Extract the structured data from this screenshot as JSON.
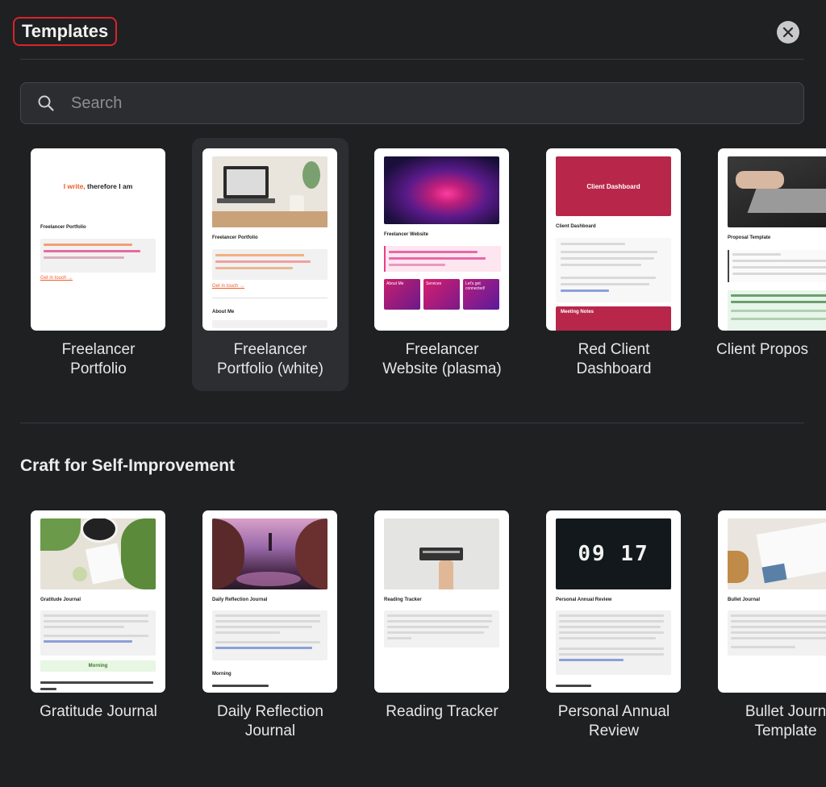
{
  "header": {
    "title": "Templates",
    "close_icon": "close-icon"
  },
  "search": {
    "placeholder": "Search",
    "value": ""
  },
  "section_top": {
    "cards": [
      {
        "label_line1": "Freelancer",
        "label_line2": "Portfolio"
      },
      {
        "label_line1": "Freelancer",
        "label_line2": "Portfolio (white)"
      },
      {
        "label_line1": "Freelancer",
        "label_line2": "Website (plasma)"
      },
      {
        "label_line1": "Red Client",
        "label_line2": "Dashboard"
      },
      {
        "label_line1": "Client Propos",
        "label_line2": ""
      }
    ]
  },
  "section_self": {
    "title": "Craft for Self-Improvement",
    "cards": [
      {
        "label_line1": "Gratitude Journal",
        "label_line2": ""
      },
      {
        "label_line1": "Daily Reflection",
        "label_line2": "Journal"
      },
      {
        "label_line1": "Reading Tracker",
        "label_line2": ""
      },
      {
        "label_line1": "Personal Annual",
        "label_line2": "Review"
      },
      {
        "label_line1": "Bullet Journ",
        "label_line2": "Template"
      }
    ]
  },
  "thumbs": {
    "t1_headline_a": "I write,",
    "t1_headline_b": " therefore I am",
    "t1_heading": "Freelancer Portfolio",
    "t1_link": "Get in touch →",
    "t2_heading": "Freelancer Portfolio",
    "t2_link": "Get in touch →",
    "t2_sub": "About Me",
    "t3_heading": "Freelancer Website",
    "t3_btn1": "About Me",
    "t3_btn2": "Services",
    "t3_btn3": "Let's get connected!",
    "t4_banner": "Client Dashboard",
    "t4_heading": "Client Dashboard",
    "t4_sub": "Meeting Notes",
    "t5_heading": "Proposal Template",
    "t6_heading": "Gratitude Journal",
    "t6_band": "Morning",
    "t7_heading": "Daily Reflection Journal",
    "t7_sub": "Morning",
    "t8_heading": "Reading Tracker",
    "t9_heading": "Personal Annual Review",
    "t9_digits": "09 17",
    "t10_heading": "Bullet Journal"
  },
  "colors": {
    "background": "#1f2022",
    "selected_card": "#2d2e31",
    "highlight_border": "#d8242d",
    "accent_orange": "#f05a28",
    "accent_pink": "#e83e8c",
    "client_red": "#b8274a"
  }
}
